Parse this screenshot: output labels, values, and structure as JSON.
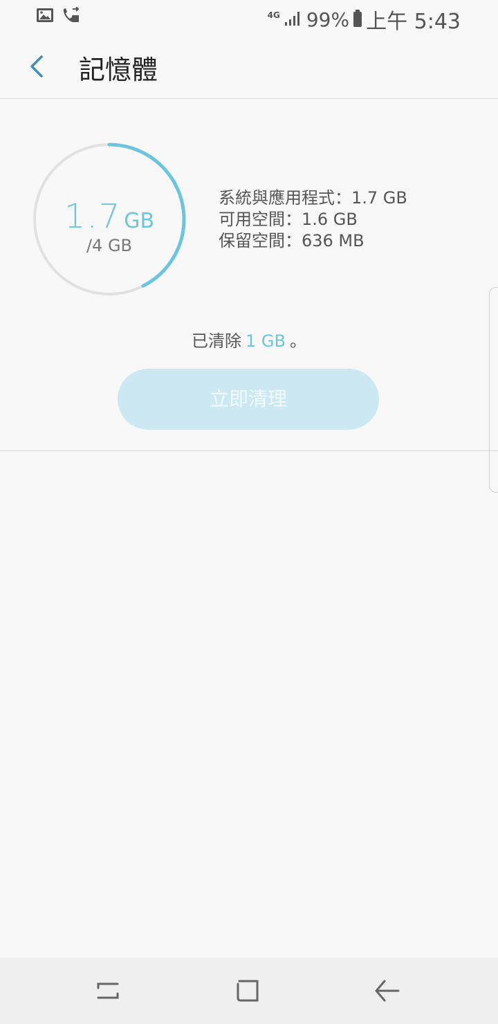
{
  "status_bar": {
    "network": "4G",
    "battery": "99%",
    "time": "上午 5:43"
  },
  "app_bar": {
    "title": "記憶體"
  },
  "memory": {
    "used_value": "1.7",
    "used_unit": "GB",
    "total_label": "/4 GB",
    "ring_fraction": 0.425,
    "details": [
      "系統與應用程式：1.7 GB",
      "可用空間：1.6 GB",
      "保留空間：636 MB"
    ],
    "cleared_prefix": "已清除",
    "cleared_amount": "1 GB",
    "cleared_suffix": "。",
    "clean_button": "立即清理"
  },
  "colors": {
    "accent": "#6cc5de",
    "button_bg": "#cbe8f3",
    "ring_track": "#e1e1e1"
  }
}
